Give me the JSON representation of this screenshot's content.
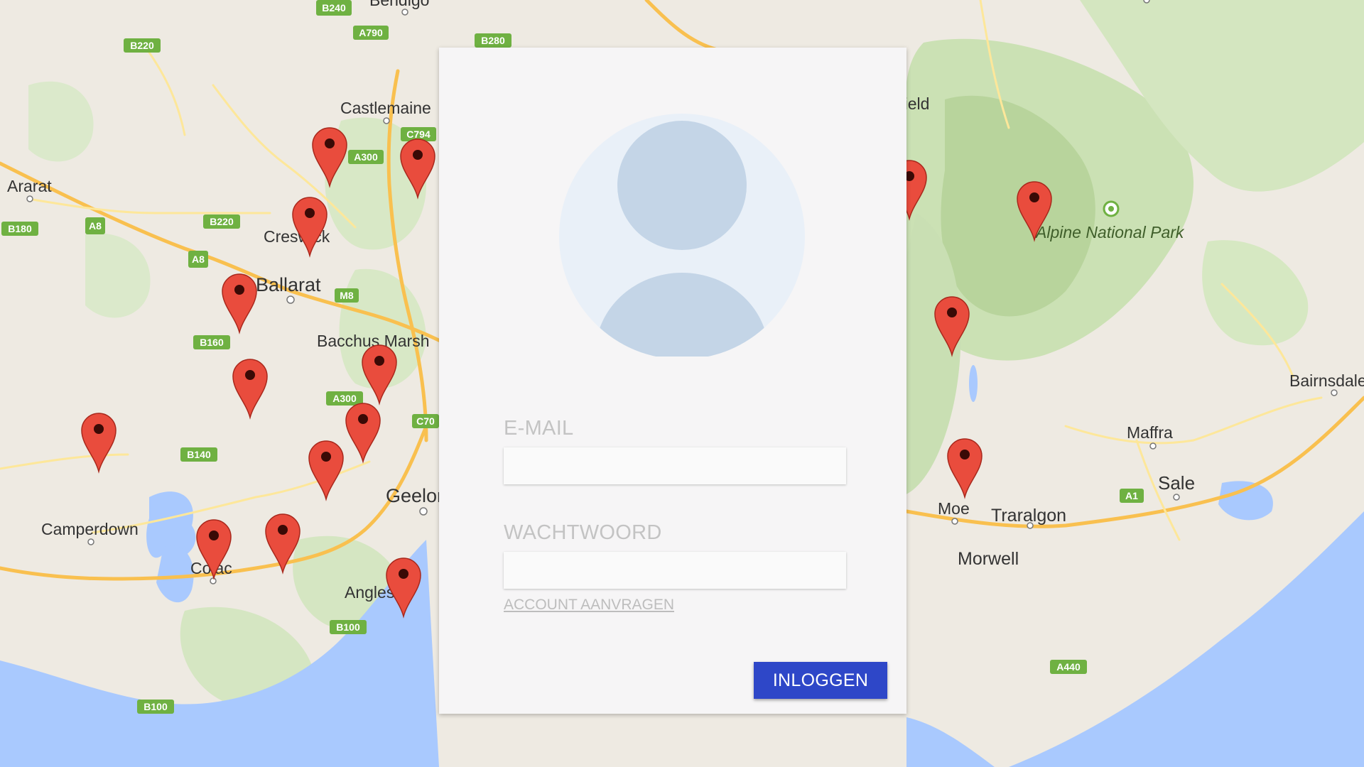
{
  "map": {
    "place_labels": [
      "Castlemaine",
      "Ararat",
      "Creswick",
      "Ballarat",
      "Bacchus Marsh",
      "Geelong",
      "Camperdown",
      "Colac",
      "Anglesea",
      "Alpine National Park",
      "Bairnsdale",
      "Maffra",
      "Sale",
      "Traralgon",
      "Moe",
      "Morwell",
      "Mansfield",
      "Bendigo"
    ],
    "road_labels": [
      "B240",
      "A790",
      "B280",
      "B220",
      "C794",
      "A300",
      "B180",
      "A8",
      "B220",
      "A8",
      "M8",
      "B160",
      "A300",
      "C70",
      "B140",
      "B100",
      "B100",
      "A1",
      "A440"
    ],
    "colors": {
      "water": "#a9c9fe",
      "land": "#eeeae2",
      "park": "#cbe1b4",
      "forest": "#b8d49c",
      "road_major": "#f9c04f",
      "road_minor": "#fde79a",
      "shield": "#6fb142",
      "marker": "#e94c3d"
    },
    "marker_icon": "map-marker-icon"
  },
  "login": {
    "avatar_icon": "user-avatar-icon",
    "email_label": "E-MAIL",
    "email_value": "",
    "password_label": "WACHTWOORD",
    "password_value": "",
    "request_account_label": "ACCOUNT AANVRAGEN",
    "submit_label": "INLOGGEN",
    "colors": {
      "card": "#f6f5f6",
      "button": "#2e47c8",
      "avatar_bg": "#e9f0f8",
      "avatar_fg": "#c4d5e7"
    }
  }
}
